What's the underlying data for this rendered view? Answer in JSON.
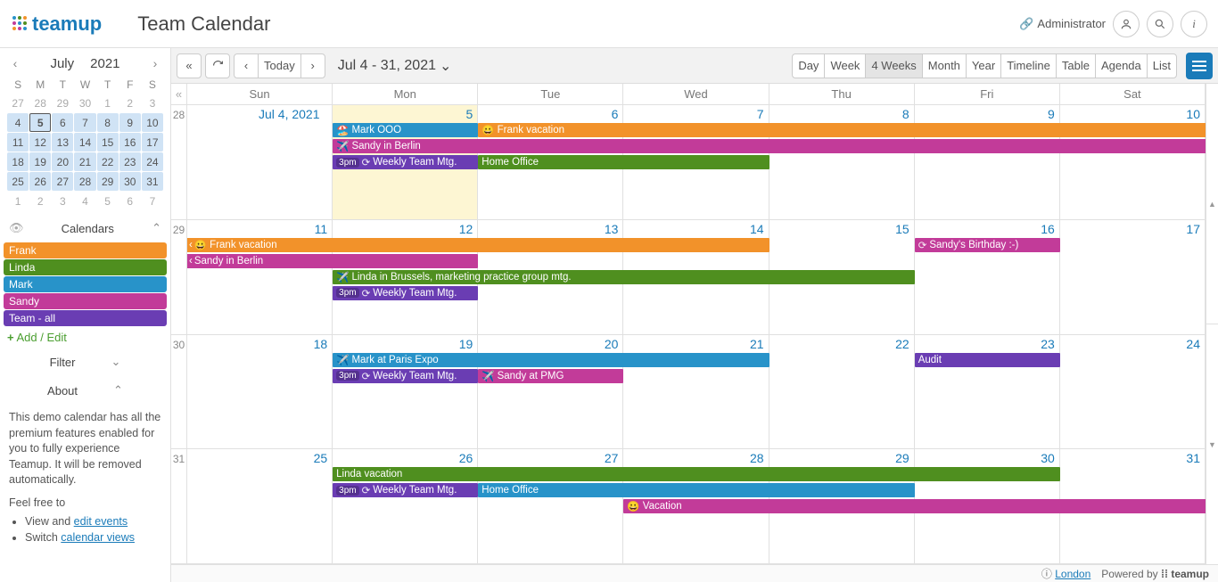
{
  "brand": {
    "name": "teamup"
  },
  "title": "Team Calendar",
  "admin_label": "Administrator",
  "toolbar": {
    "today": "Today",
    "range": "Jul 4 - 31, 2021",
    "views": [
      "Day",
      "Week",
      "4 Weeks",
      "Month",
      "Year",
      "Timeline",
      "Table",
      "Agenda",
      "List"
    ],
    "active_view": 2
  },
  "mini": {
    "month": "July",
    "year": "2021",
    "dow": [
      "S",
      "M",
      "T",
      "W",
      "T",
      "F",
      "S"
    ],
    "cells": [
      {
        "d": 27,
        "o": true
      },
      {
        "d": 28,
        "o": true
      },
      {
        "d": 29,
        "o": true
      },
      {
        "d": 30,
        "o": true
      },
      {
        "d": 1,
        "o": true
      },
      {
        "d": 2,
        "o": true
      },
      {
        "d": 3,
        "o": true
      },
      {
        "d": 4
      },
      {
        "d": 5,
        "t": true
      },
      {
        "d": 6
      },
      {
        "d": 7
      },
      {
        "d": 8
      },
      {
        "d": 9
      },
      {
        "d": 10
      },
      {
        "d": 11
      },
      {
        "d": 12
      },
      {
        "d": 13
      },
      {
        "d": 14
      },
      {
        "d": 15
      },
      {
        "d": 16
      },
      {
        "d": 17
      },
      {
        "d": 18
      },
      {
        "d": 19
      },
      {
        "d": 20
      },
      {
        "d": 21
      },
      {
        "d": 22
      },
      {
        "d": 23
      },
      {
        "d": 24
      },
      {
        "d": 25
      },
      {
        "d": 26
      },
      {
        "d": 27
      },
      {
        "d": 28
      },
      {
        "d": 29
      },
      {
        "d": 30
      },
      {
        "d": 31
      },
      {
        "d": 1,
        "o": true
      },
      {
        "d": 2,
        "o": true
      },
      {
        "d": 3,
        "o": true
      },
      {
        "d": 4,
        "o": true
      },
      {
        "d": 5,
        "o": true
      },
      {
        "d": 6,
        "o": true
      },
      {
        "d": 7,
        "o": true
      }
    ]
  },
  "sections": {
    "calendars": "Calendars",
    "filter": "Filter",
    "about": "About"
  },
  "calendars": [
    {
      "name": "Frank",
      "color": "#f2922a"
    },
    {
      "name": "Linda",
      "color": "#4f8f1f"
    },
    {
      "name": "Mark",
      "color": "#2893c9"
    },
    {
      "name": "Sandy",
      "color": "#c23b99"
    },
    {
      "name": "Team - all",
      "color": "#6a3db3"
    }
  ],
  "add_edit": "Add / Edit",
  "about": {
    "p1": "This demo calendar has all the premium features enabled for you to fully experience Teamup. It will be removed automatically.",
    "p2": "Feel free to",
    "li1_pre": "View and ",
    "li1_link": "edit events",
    "li2_pre": "Switch ",
    "li2_link": "calendar views"
  },
  "grid": {
    "dow": [
      "Sun",
      "Mon",
      "Tue",
      "Wed",
      "Thu",
      "Fri",
      "Sat"
    ],
    "wknums": [
      "28",
      "29",
      "30",
      "31"
    ],
    "weeks": [
      {
        "days": [
          "Jul 4, 2021",
          "5",
          "6",
          "7",
          "8",
          "9",
          "10"
        ],
        "today_idx": 1,
        "rows": [
          [
            {
              "c": 1,
              "s": 1,
              "t": "Mark OOO",
              "bg": "#2893c9",
              "emoji": "🏖️"
            },
            {
              "c": 2,
              "s": 5,
              "t": "Frank vacation",
              "bg": "#f2922a",
              "emoji": "😀",
              "cr": true
            }
          ],
          [
            {
              "c": 1,
              "s": 6,
              "t": "Sandy in Berlin",
              "bg": "#c23b99",
              "emoji": "✈️",
              "cr": true
            }
          ],
          [
            {
              "c": 1,
              "s": 1,
              "t": "Weekly Team Mtg.",
              "bg": "#6a3db3",
              "time": "3pm",
              "recur": true
            },
            {
              "c": 2,
              "s": 2,
              "t": "Home Office",
              "bg": "#4f8f1f"
            }
          ]
        ]
      },
      {
        "days": [
          "11",
          "12",
          "13",
          "14",
          "15",
          "16",
          "17"
        ],
        "rows": [
          [
            {
              "c": 0,
              "s": 4,
              "t": "Frank vacation",
              "bg": "#f2922a",
              "emoji": "😀",
              "cl": true
            },
            {
              "c": 5,
              "s": 1,
              "t": "Sandy's Birthday :-)",
              "bg": "#c23b99",
              "recur": true
            }
          ],
          [
            {
              "c": 0,
              "s": 2,
              "t": "Sandy in Berlin",
              "bg": "#c23b99",
              "cl": true
            }
          ],
          [
            {
              "c": 1,
              "s": 4,
              "t": "Linda in Brussels, marketing practice group mtg.",
              "bg": "#4f8f1f",
              "emoji": "✈️"
            }
          ],
          [
            {
              "c": 1,
              "s": 1,
              "t": "Weekly Team Mtg.",
              "bg": "#6a3db3",
              "time": "3pm",
              "recur": true
            }
          ]
        ]
      },
      {
        "days": [
          "18",
          "19",
          "20",
          "21",
          "22",
          "23",
          "24"
        ],
        "rows": [
          [
            {
              "c": 1,
              "s": 3,
              "t": "Mark at Paris Expo",
              "bg": "#2893c9",
              "emoji": "✈️"
            },
            {
              "c": 5,
              "s": 1,
              "t": "Audit",
              "bg": "#6a3db3"
            }
          ],
          [
            {
              "c": 1,
              "s": 1,
              "t": "Weekly Team Mtg.",
              "bg": "#6a3db3",
              "time": "3pm",
              "recur": true
            },
            {
              "c": 2,
              "s": 1,
              "t": "Sandy at PMG",
              "bg": "#c23b99",
              "emoji": "✈️"
            }
          ]
        ]
      },
      {
        "days": [
          "25",
          "26",
          "27",
          "28",
          "29",
          "30",
          "31"
        ],
        "rows": [
          [
            {
              "c": 1,
              "s": 5,
              "t": "Linda vacation",
              "bg": "#4f8f1f"
            }
          ],
          [
            {
              "c": 1,
              "s": 1,
              "t": "Weekly Team Mtg.",
              "bg": "#6a3db3",
              "time": "3pm",
              "recur": true
            },
            {
              "c": 2,
              "s": 3,
              "t": "Home Office",
              "bg": "#2893c9"
            }
          ],
          [
            {
              "c": 3,
              "s": 4,
              "t": "Vacation",
              "bg": "#c23b99",
              "emoji": "😀",
              "cr": true
            }
          ]
        ]
      }
    ]
  },
  "footer": {
    "tz": "London",
    "powered": "Powered by"
  }
}
